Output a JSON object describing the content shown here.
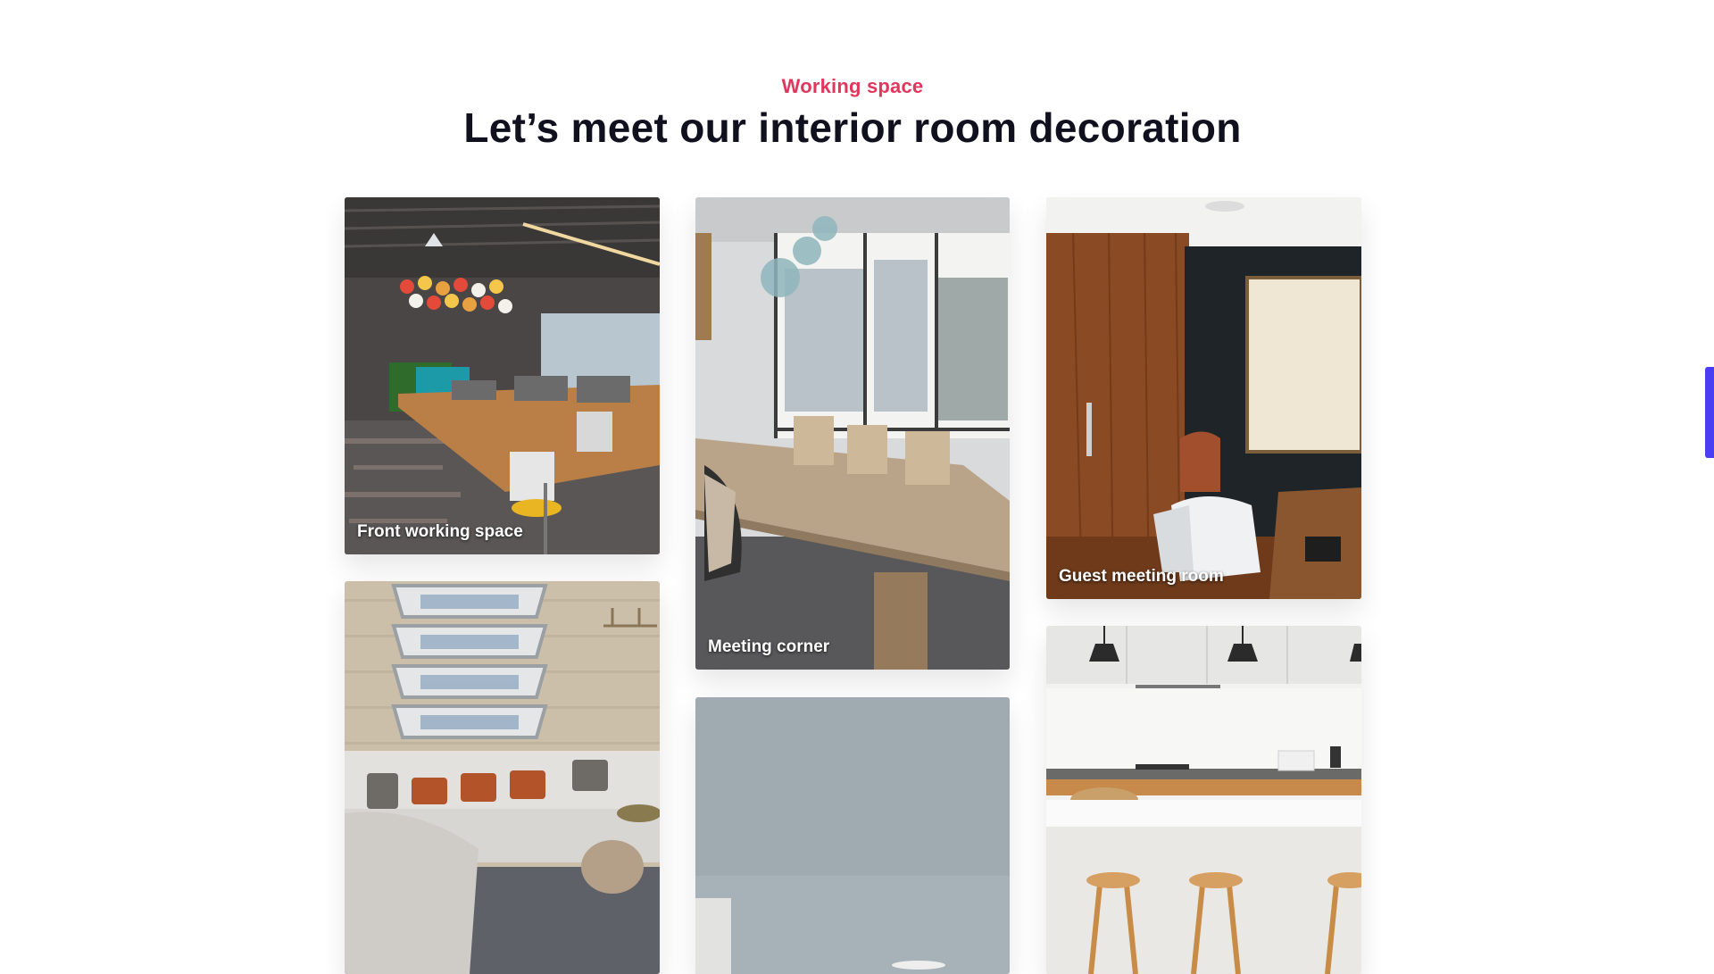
{
  "section": {
    "eyebrow": "Working space",
    "title": "Let’s meet our interior room decoration",
    "accent_color": "#e2365d",
    "title_color": "#10101e"
  },
  "gallery": [
    {
      "caption": "Front working space",
      "image": "open-office-photo"
    },
    {
      "caption": "Meeting corner",
      "image": "meeting-room-photo"
    },
    {
      "caption": "Guest meeting room",
      "image": "guest-room-photo"
    },
    {
      "caption": "",
      "image": "living-room-photo"
    },
    {
      "caption": "",
      "image": "grey-wall-photo"
    },
    {
      "caption": "",
      "image": "kitchen-photo"
    }
  ],
  "side_tab": {
    "color": "#4a3ef5"
  }
}
